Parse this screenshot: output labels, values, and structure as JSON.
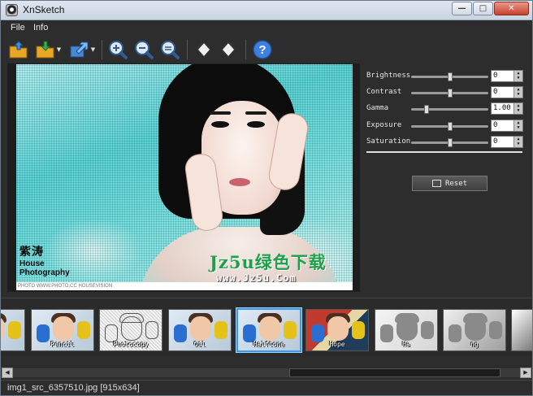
{
  "window": {
    "title": "XnSketch"
  },
  "menu": {
    "items": [
      {
        "label": "File"
      },
      {
        "label": "Info"
      }
    ]
  },
  "toolbar": {
    "buttons": [
      {
        "icon": "open-folder-icon"
      },
      {
        "icon": "save-icon"
      },
      {
        "icon": "export-icon"
      },
      {
        "icon": "zoom-in-icon"
      },
      {
        "icon": "zoom-out-icon"
      },
      {
        "icon": "zoom-fit-icon"
      },
      {
        "icon": "rotate-left-icon"
      },
      {
        "icon": "rotate-right-icon"
      },
      {
        "icon": "help-icon"
      }
    ]
  },
  "photo": {
    "logo_seal": "紫涛",
    "logo_line1": "House",
    "logo_line2": "Photography",
    "caption": "PHOTO WWW.PHOTO.CC HOUSEVISION",
    "watermark_cn": "Jz5u绿色下载",
    "watermark_url": "www.Jz5u.Com"
  },
  "adjustments": {
    "items": [
      {
        "label": "Brightness",
        "value": "0",
        "level": 0.5
      },
      {
        "label": "Contrast",
        "value": "0",
        "level": 0.5
      },
      {
        "label": "Gamma",
        "value": "1.00",
        "level": 0.18
      },
      {
        "label": "Exposure",
        "value": "0",
        "level": 0.5
      },
      {
        "label": "Saturation",
        "value": "0",
        "level": 0.5
      }
    ],
    "reset_label": "Reset"
  },
  "effects": {
    "items": [
      {
        "label": "l",
        "style": "color",
        "selected": false
      },
      {
        "label": "Pencil",
        "style": "color",
        "selected": false
      },
      {
        "label": "Photocopy",
        "style": "sketch",
        "selected": false
      },
      {
        "label": "Oil",
        "style": "color",
        "selected": false
      },
      {
        "label": "Halftone",
        "style": "color",
        "selected": true
      },
      {
        "label": "Hope",
        "style": "hope",
        "selected": false
      },
      {
        "label": "Ha",
        "style": "faded",
        "selected": false
      },
      {
        "label": "ng",
        "style": "gray",
        "selected": false
      },
      {
        "label": "",
        "style": "bw",
        "selected": false
      }
    ]
  },
  "status": {
    "text": "img1_src_6357510.jpg [915x634]"
  }
}
